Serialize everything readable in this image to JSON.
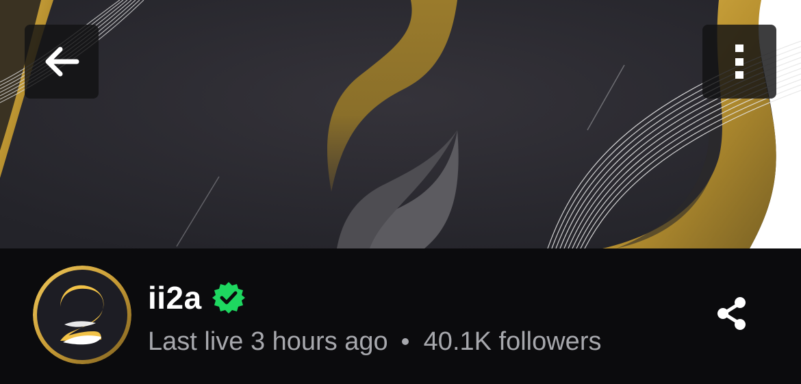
{
  "header": {
    "back_icon": "arrow-left-icon",
    "more_icon": "vertical-dots-icon"
  },
  "channel": {
    "name": "ii2a",
    "verified": true,
    "verified_color": "#1ed760",
    "last_live": "Last live 3 hours ago",
    "followers": "40.1K followers",
    "share_icon": "share-icon"
  },
  "colors": {
    "banner_bg": "#2a2a30",
    "gold": "#c99e3a",
    "info_bg": "#0b0b0d"
  }
}
